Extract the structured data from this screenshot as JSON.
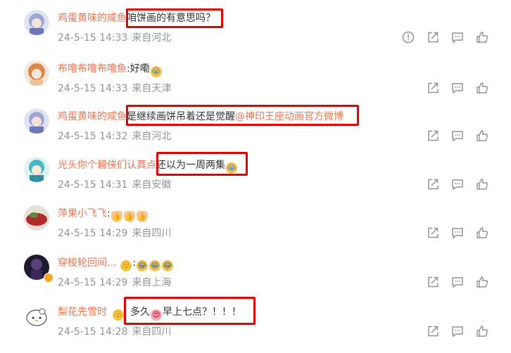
{
  "comments": [
    {
      "user": "鸡蛋黄味的咸鱼",
      "text": "咱饼画的有意思吗？",
      "date": "24-5-15 14:33",
      "location": "来自河北",
      "avatar": "anime-girl-purple-hair-avatar",
      "report_icon": true
    },
    {
      "user": "布噜布噜布噜鱼",
      "text": "好嘞",
      "date": "24-5-15 14:33",
      "location": "来自天津",
      "avatar": "anime-girl-orange-hair-avatar"
    },
    {
      "user": "鸡蛋黄味的咸鱼",
      "text": "是继续画饼吊着还是觉醒",
      "mention": "@神印王座动画官方微博",
      "date": "24-5-15 14:32",
      "location": "来自河北",
      "avatar": "anime-girl-purple-hair-avatar"
    },
    {
      "user": "光头你个碧侠们认真点",
      "text": "还以为一周两集",
      "date": "24-5-15 14:31",
      "location": "来自安徽",
      "avatar": "anime-girl-teal-hair-avatar"
    },
    {
      "user": "萍果小飞飞",
      "text": "",
      "date": "24-5-15 14:29",
      "location": "来自四川",
      "avatar": "red-object-avatar"
    },
    {
      "user": "穿梭轮回间",
      "text": "",
      "date": "24-5-15 14:29",
      "location": "来自上海",
      "avatar": "dark-character-avatar"
    },
    {
      "user": "梨花先雪时",
      "text": "多久",
      "text2": "早上七点？！！！",
      "date": "24-5-15 14:28",
      "location": "来自四川",
      "avatar": "hello-kitty-avatar"
    }
  ],
  "icons": {
    "report": "report-icon",
    "share": "share-icon",
    "comment": "comment-icon",
    "like": "like-icon"
  },
  "colors": {
    "username": "#eb7350",
    "highlight": "#e60000",
    "meta": "#939393",
    "icon": "#939393"
  }
}
